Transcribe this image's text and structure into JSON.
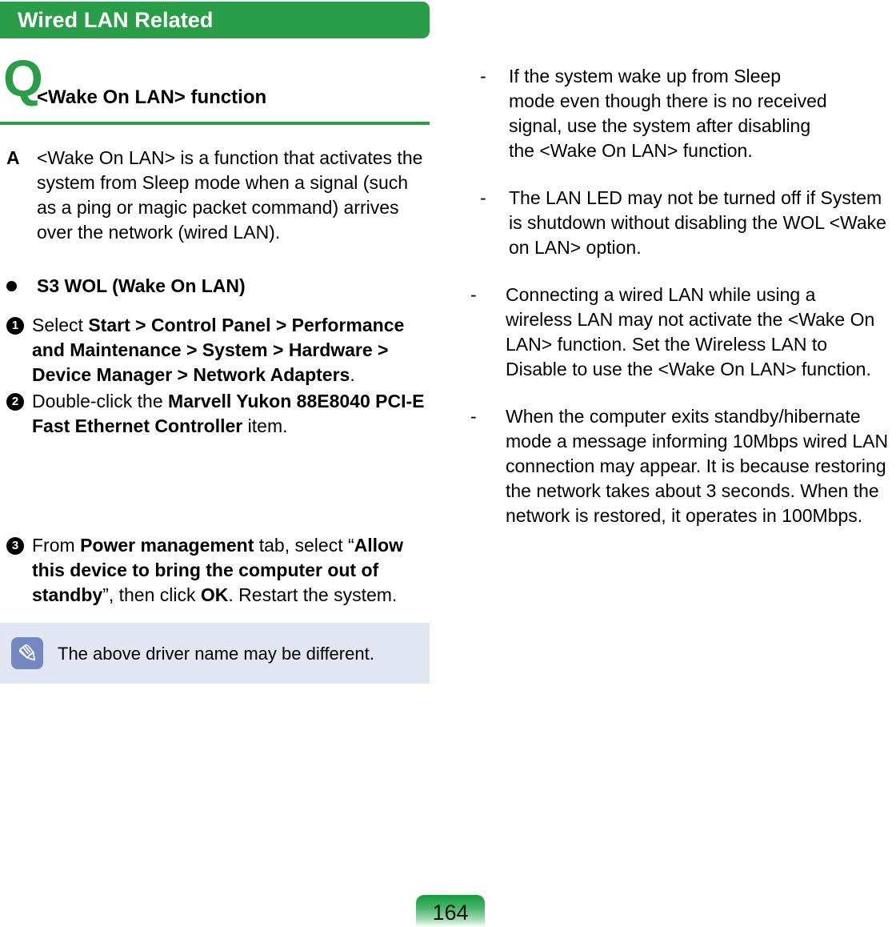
{
  "header": {
    "title": "Wired LAN Related",
    "bar_color": "#2a9d48"
  },
  "question": {
    "marker": "Q",
    "title": "<Wake On LAN> function",
    "rule_color": "#2a9d48"
  },
  "answer": {
    "marker": "A",
    "text": "<Wake On LAN> is a function that activates the system from Sleep mode when a signal (such as a ping or magic packet command) arrives over the network (wired LAN)."
  },
  "section": {
    "bullet_glyph": "bullet-dot",
    "heading": "S3 WOL (Wake On LAN)"
  },
  "steps": [
    {
      "number": "1",
      "parts": [
        {
          "text": "Select ",
          "bold": false
        },
        {
          "text": "Start > Control Panel > Performance and Maintenance > System > Hardware > Device Manager > Network Adapters",
          "bold": true
        },
        {
          "text": ".",
          "bold": false
        }
      ]
    },
    {
      "number": "2",
      "parts": [
        {
          "text": "Double-click the ",
          "bold": false
        },
        {
          "text": "Marvell Yukon 88E8040 PCI-E Fast Ethernet Controller",
          "bold": true
        },
        {
          "text": " item.",
          "bold": false
        }
      ]
    },
    {
      "number": "3",
      "parts": [
        {
          "text": "From ",
          "bold": false
        },
        {
          "text": "Power management",
          "bold": true
        },
        {
          "text": " tab, select “",
          "bold": false
        },
        {
          "text": "Allow this device to bring the computer out of standby",
          "bold": true
        },
        {
          "text": "”, then click ",
          "bold": false
        },
        {
          "text": "OK",
          "bold": true
        },
        {
          "text": ". Restart the system.",
          "bold": false
        }
      ]
    }
  ],
  "note": {
    "icon": "pencil-icon",
    "icon_bg": "#7289bf",
    "box_bg": "#e2e6f2",
    "text": "The above driver name may be different."
  },
  "notes_right": {
    "dash": "-",
    "items": [
      "If the system wake up from Sleep mode even though there is no received signal, use the system after disabling the <Wake On LAN> function.",
      "The LAN LED may not be turned off if System is shutdown without disabling the WOL <Wake on LAN> option.",
      "Connecting a wired LAN while using a wireless LAN may not activate the <Wake On LAN> function. Set the Wireless LAN to Disable to use the <Wake On LAN> function.",
      "When the computer exits standby/hibernate mode a message informing 10Mbps wired LAN connection may appear. It is because restoring the network takes about 3 seconds. When the network is restored, it operates in 100Mbps."
    ]
  },
  "footer": {
    "page_number": "164",
    "badge_color_top": "#109d3f"
  }
}
